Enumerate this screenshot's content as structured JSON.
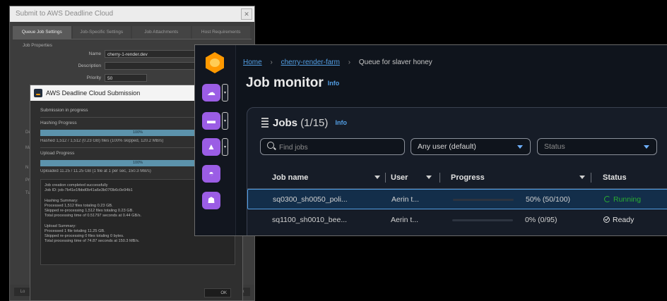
{
  "submitter": {
    "title": "Submit to AWS Deadline Cloud",
    "tabs": [
      "Queue Job Settings",
      "Job-Specific Settings",
      "Job Attachments",
      "Host Requirements"
    ],
    "section": "Job Properties",
    "fields": [
      {
        "label": "Name",
        "value": "cherry-1-render.dev"
      },
      {
        "label": "Description",
        "value": ""
      },
      {
        "label": "Priority",
        "value": "50"
      }
    ],
    "side_ticks": [
      "De",
      "Ma",
      "N",
      "Pr",
      "Tu"
    ],
    "bottom_buttons": [
      "Lo",
      "Ex"
    ]
  },
  "submission_dialog": {
    "title": "AWS Deadline Cloud Submission",
    "heading": "Submission in progress",
    "hashing": {
      "label": "Hashing Progress",
      "bar_text": "100%",
      "progress": 1.0,
      "stat": "Hashed 1,512 / 1,512 (0.23 GB) files (100% skipped, 120.2 MB/s)"
    },
    "upload": {
      "label": "Upload Progress",
      "bar_text": "100%",
      "progress": 1.0,
      "stat": "Uploaded 11.25 / 11.25 GB (1 file at 1 per sec, 150.3 MB/s)"
    },
    "log": [
      "Job creation completed successfully",
      "Job ID: job-7b41e1fbbd0b41a6e3b07f3b6c0e94b1",
      "",
      "Hashing Summary:",
      "  Processed 1,512 files totaling 0.23 GB.",
      "  Skipped re-processing 1,512 files totaling 0.23 GB.",
      "  Total processing time of 0.51797 seconds at 0.44 GB/s.",
      "",
      "Upload Summary:",
      "  Processed 1 file totaling 11.25 GB.",
      "  Skipped re-processing 0 files totaling 0 bytes.",
      "  Total processing time of 74.87 seconds at 150.3 MB/s."
    ],
    "ok_label": "OK"
  },
  "monitor": {
    "breadcrumb": {
      "home": "Home",
      "farm": "cherry-render-farm",
      "queue": "Queue for slaver honey"
    },
    "title": "Job monitor",
    "info": "Info",
    "jobs": {
      "label": "Jobs",
      "count": "(1/15)",
      "info": "Info",
      "search_placeholder": "Find jobs",
      "user_filter": "Any user (default)",
      "status_placeholder": "Status",
      "columns": [
        "Job name",
        "User",
        "Progress",
        "Status"
      ],
      "rows": [
        {
          "name": "sq0300_sh0050_poli...",
          "user": "Aerin t...",
          "progress": 0.5,
          "progress_text": "50% (50/100)",
          "status": "Running"
        },
        {
          "name": "sq1100_sh0010_bee...",
          "user": "Aerin t...",
          "progress": 0.0,
          "progress_text": "0% (0/95)",
          "status": "Ready"
        }
      ]
    },
    "rail_icons": [
      "farm-icon",
      "queue-icon",
      "fleet-icon",
      "jobs-icon",
      "workers-icon"
    ]
  },
  "colors": {
    "accent_link": "#539fe5",
    "rail_purple": "#9b5de5",
    "status_running": "#29ad32",
    "progress_bar": "#5c93ac",
    "aws_orange": "#ff9900"
  }
}
